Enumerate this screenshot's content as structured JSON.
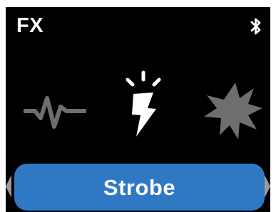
{
  "header": {
    "title": "FX",
    "status_icon": "bluetooth-icon"
  },
  "effects": {
    "items": [
      {
        "icon": "heartbeat-pulse-icon",
        "state": "inactive"
      },
      {
        "icon": "strobe-lightning-icon",
        "state": "selected"
      },
      {
        "icon": "burst-icon",
        "state": "inactive"
      }
    ],
    "selected_label": "Strobe",
    "nav": {
      "previous_icon": "chevron-left-icon",
      "next_icon": "chevron-right-icon"
    }
  },
  "colors": {
    "background": "#000000",
    "accent": "#2f78c4",
    "active_icon": "#ffffff",
    "inactive_icon": "#6e6e6e",
    "nav_arrow": "#9a9a9a"
  }
}
